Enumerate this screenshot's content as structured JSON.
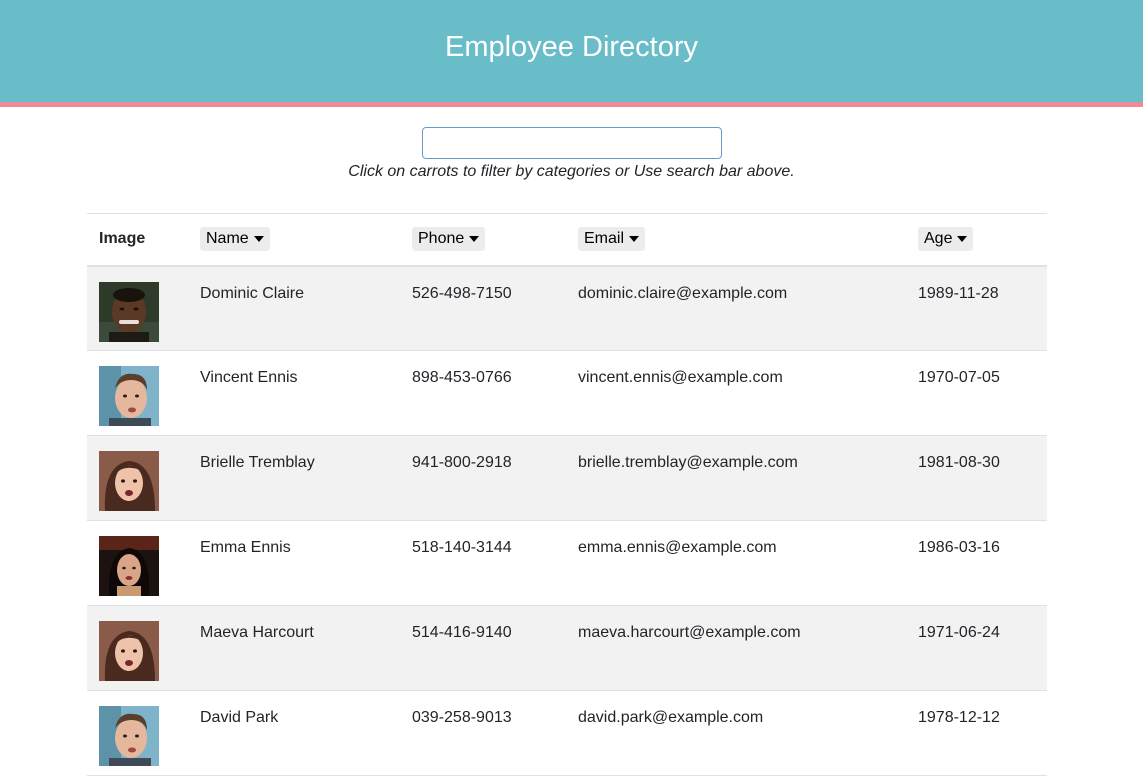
{
  "header": {
    "title": "Employee Directory"
  },
  "search": {
    "value": "",
    "placeholder": "",
    "hint": "Click on carrots to filter by categories or Use search bar above."
  },
  "table": {
    "columns": [
      {
        "label": "Image",
        "sortable": false
      },
      {
        "label": "Name",
        "sortable": true
      },
      {
        "label": "Phone",
        "sortable": true
      },
      {
        "label": "Email",
        "sortable": true
      },
      {
        "label": "Age",
        "sortable": true
      }
    ],
    "rows": [
      {
        "avatar": "avatar-male-dark",
        "name": "Dominic Claire",
        "phone": "526-498-7150",
        "email": "dominic.claire@example.com",
        "age": "1989-11-28"
      },
      {
        "avatar": "avatar-male-light",
        "name": "Vincent Ennis",
        "phone": "898-453-0766",
        "email": "vincent.ennis@example.com",
        "age": "1970-07-05"
      },
      {
        "avatar": "avatar-female-brunette",
        "name": "Brielle Tremblay",
        "phone": "941-800-2918",
        "email": "brielle.tremblay@example.com",
        "age": "1981-08-30"
      },
      {
        "avatar": "avatar-female-dark-hair",
        "name": "Emma Ennis",
        "phone": "518-140-3144",
        "email": "emma.ennis@example.com",
        "age": "1986-03-16"
      },
      {
        "avatar": "avatar-female-brunette",
        "name": "Maeva Harcourt",
        "phone": "514-416-9140",
        "email": "maeva.harcourt@example.com",
        "age": "1971-06-24"
      },
      {
        "avatar": "avatar-male-light",
        "name": "David Park",
        "phone": "039-258-9013",
        "email": "david.park@example.com",
        "age": "1978-12-12"
      }
    ]
  },
  "colors": {
    "header_bg": "#69bdc8",
    "header_border": "#ef8a98",
    "row_stripe": "#f2f2f2",
    "sort_button_bg": "#ececec"
  },
  "icons": {
    "sort": "caret-down-icon"
  }
}
